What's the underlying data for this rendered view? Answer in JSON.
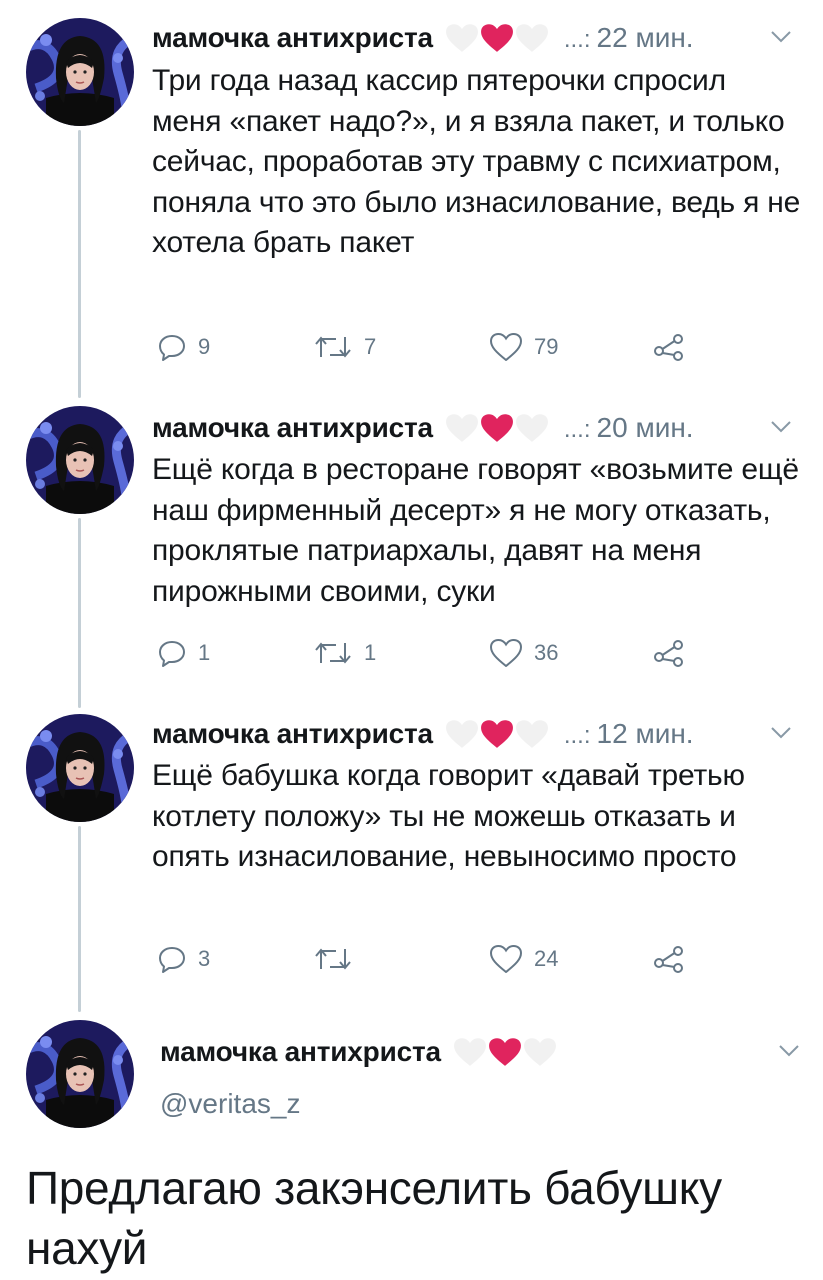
{
  "author": {
    "name": "мамочка антихриста",
    "handle": "@veritas_z"
  },
  "colors": {
    "heart_red": "#e0245e",
    "heart_white": "#f1f1f1",
    "muted": "#657786",
    "thread": "#c4cfd6"
  },
  "tweets": [
    {
      "dots": "...:",
      "time": "22 мин.",
      "text": "Три года назад кассир пятерочки спросил меня «пакет надо?», и я взяла пакет, и только сейчас, проработав эту травму с психиатром, поняла что это было изнасилование, ведь я не хотела брать пакет",
      "replies": "9",
      "retweets": "7",
      "likes": "79"
    },
    {
      "dots": "...:",
      "time": "20 мин.",
      "text": "Ещё когда в ресторане говорят «возьмите ещё наш фирменный десерт» я не могу отказать, проклятые патриархалы, давят на меня пирожными своими, суки",
      "replies": "1",
      "retweets": "1",
      "likes": "36"
    },
    {
      "dots": "...:",
      "time": "12 мин.",
      "text": "Ещё бабушка когда говорит «давай третью котлету положу» ты не можешь отказать и опять изнасилование, невыносимо просто",
      "replies": "3",
      "retweets": "",
      "likes": "24"
    }
  ],
  "main_tweet": {
    "text": "Предлагаю закэнселить бабушку нахуй"
  }
}
